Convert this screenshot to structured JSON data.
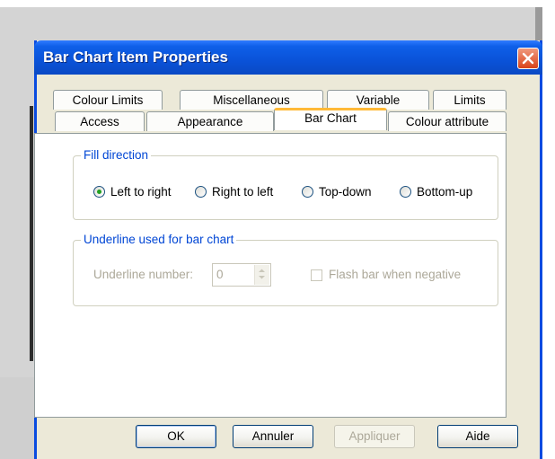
{
  "dialog": {
    "title": "Bar Chart Item Properties"
  },
  "tabs": {
    "row_back": [
      "Colour Limits",
      "Miscellaneous",
      "Variable",
      "Limits"
    ],
    "row_front": [
      "Access",
      "Appearance",
      "Bar Chart",
      "Colour attribute"
    ],
    "active": "Bar Chart"
  },
  "fill_direction": {
    "label": "Fill direction",
    "options": [
      "Left to right",
      "Right to left",
      "Top-down",
      "Bottom-up"
    ],
    "selected": "Left to right"
  },
  "underline": {
    "label": "Underline used for bar chart",
    "number_label": "Underline number:",
    "number_value": "0",
    "flash_label": "Flash bar when negative",
    "flash_checked": false
  },
  "buttons": {
    "ok": "OK",
    "cancel": "Annuler",
    "apply": "Appliquer",
    "help": "Aide"
  },
  "colors": {
    "titlebar": "#0a52d8",
    "dialog_bg": "#ece9d8",
    "active_tab_accent": "#ffb937",
    "group_label": "#0046d5",
    "disabled_text": "#aca899"
  },
  "icons": {
    "close": "close-icon",
    "radio_selected": "radio-selected",
    "spinner": "spin-arrows-icon"
  }
}
